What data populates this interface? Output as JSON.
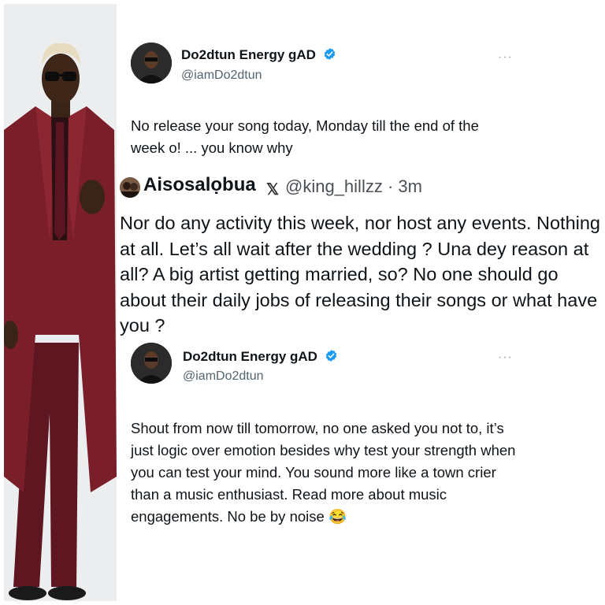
{
  "tweet1": {
    "display_name": "Do2dtun Energy gAD",
    "handle": "@iamDo2dtun",
    "more": "···",
    "text": "No release your song today, Monday till the end of the week o! ... you know why"
  },
  "reply": {
    "display_name": "Aisosalọbua",
    "x_logo": "𝕏",
    "handle_time": "@king_hillzz · 3m",
    "text": "Nor do any activity this week, nor host any events. Nothing at all. Let’s all wait after the wedding ? Una dey reason at all? A big artist getting married, so? No one should go about their daily jobs of releasing their songs or what have you ?"
  },
  "tweet2": {
    "display_name": "Do2dtun Energy gAD",
    "handle": "@iamDo2dtun",
    "more": "···",
    "text": "Shout from now till tomorrow, no one asked you not to, it’s just logic over emotion besides why test your strength when you can test your mind. You sound more like a town crier than a music enthusiast.  Read more about music engagements. No be by noise 😂"
  },
  "colors": {
    "verified": "#1d9bf0",
    "suit": "#6e1a24",
    "handle_gray": "#536471"
  },
  "icons": [
    "verified-badge-icon",
    "more-options-icon",
    "x-logo-icon"
  ]
}
